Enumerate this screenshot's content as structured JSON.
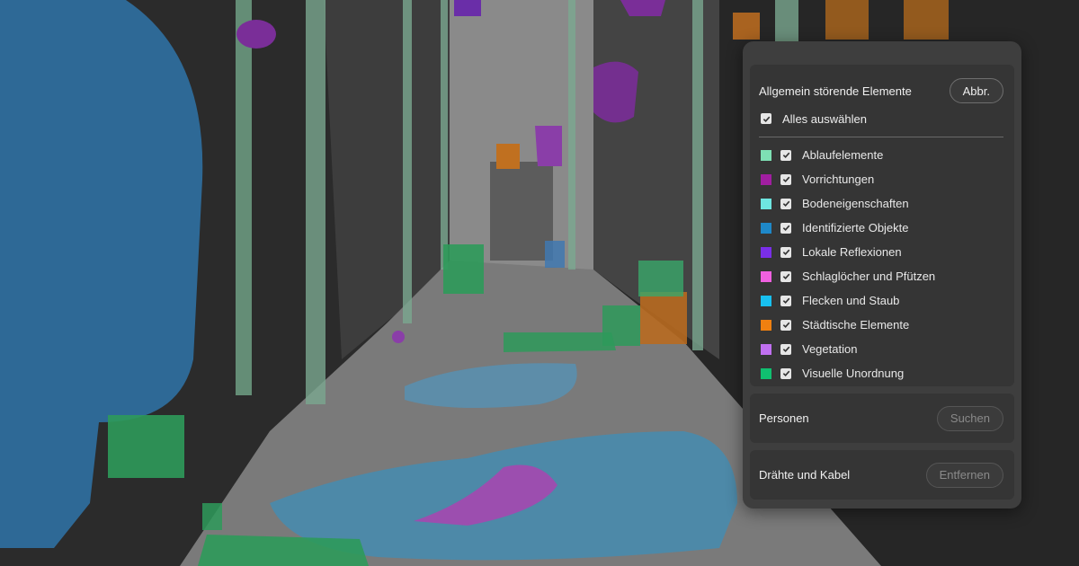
{
  "panel": {
    "distractions": {
      "title": "Allgemein störende Elemente",
      "cancel_label": "Abbr.",
      "select_all_label": "Alles auswählen",
      "select_all_checked": true,
      "items": [
        {
          "label": "Ablaufelemente",
          "color": "#7ee0b4",
          "checked": true
        },
        {
          "label": "Vorrichtungen",
          "color": "#a01ea0",
          "checked": true
        },
        {
          "label": "Bodeneigenschaften",
          "color": "#6ee6e0",
          "checked": true
        },
        {
          "label": "Identifizierte Objekte",
          "color": "#1e88c8",
          "checked": true
        },
        {
          "label": "Lokale Reflexionen",
          "color": "#7a2ee8",
          "checked": true
        },
        {
          "label": "Schlaglöcher und Pfützen",
          "color": "#f060e0",
          "checked": true
        },
        {
          "label": "Flecken und Staub",
          "color": "#18c0f0",
          "checked": true
        },
        {
          "label": "Städtische Elemente",
          "color": "#f08010",
          "checked": true
        },
        {
          "label": "Vegetation",
          "color": "#c070f0",
          "checked": true
        },
        {
          "label": "Visuelle Unordnung",
          "color": "#10c070",
          "checked": true
        }
      ]
    },
    "people": {
      "title": "Personen",
      "button_label": "Suchen"
    },
    "wires": {
      "title": "Drähte und Kabel",
      "button_label": "Entfernen"
    }
  }
}
